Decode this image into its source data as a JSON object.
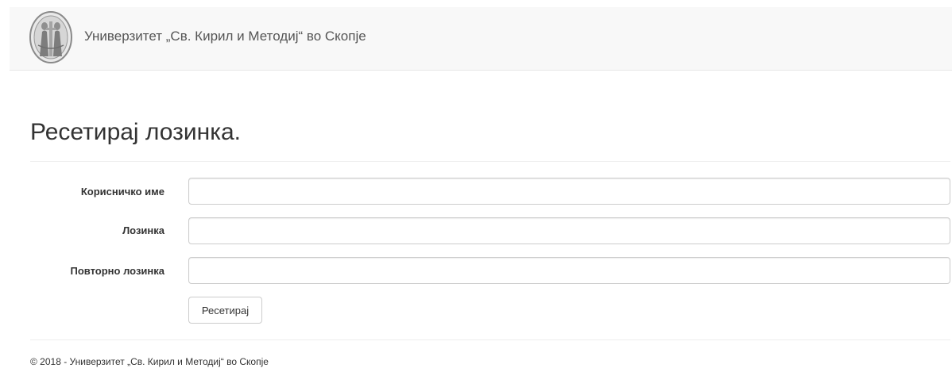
{
  "header": {
    "brand_text": "Универзитет „Св. Кирил и Методиј“ во Скопје",
    "logo_icon": "university-seal-icon"
  },
  "page": {
    "title": "Ресетирај лозинка."
  },
  "form": {
    "fields": [
      {
        "label": "Корисничко име",
        "value": "",
        "placeholder": ""
      },
      {
        "label": "Лозинка",
        "value": "",
        "placeholder": ""
      },
      {
        "label": "Повторно лозинка",
        "value": "",
        "placeholder": ""
      }
    ],
    "submit_label": "Ресетирај"
  },
  "footer": {
    "text": "© 2018 - Универзитет „Св. Кирил и Методиј“ во Скопје"
  },
  "colors": {
    "navbar_bg": "#f8f8f8",
    "text": "#333333",
    "brand_text": "#555555",
    "input_border": "#cccccc"
  }
}
